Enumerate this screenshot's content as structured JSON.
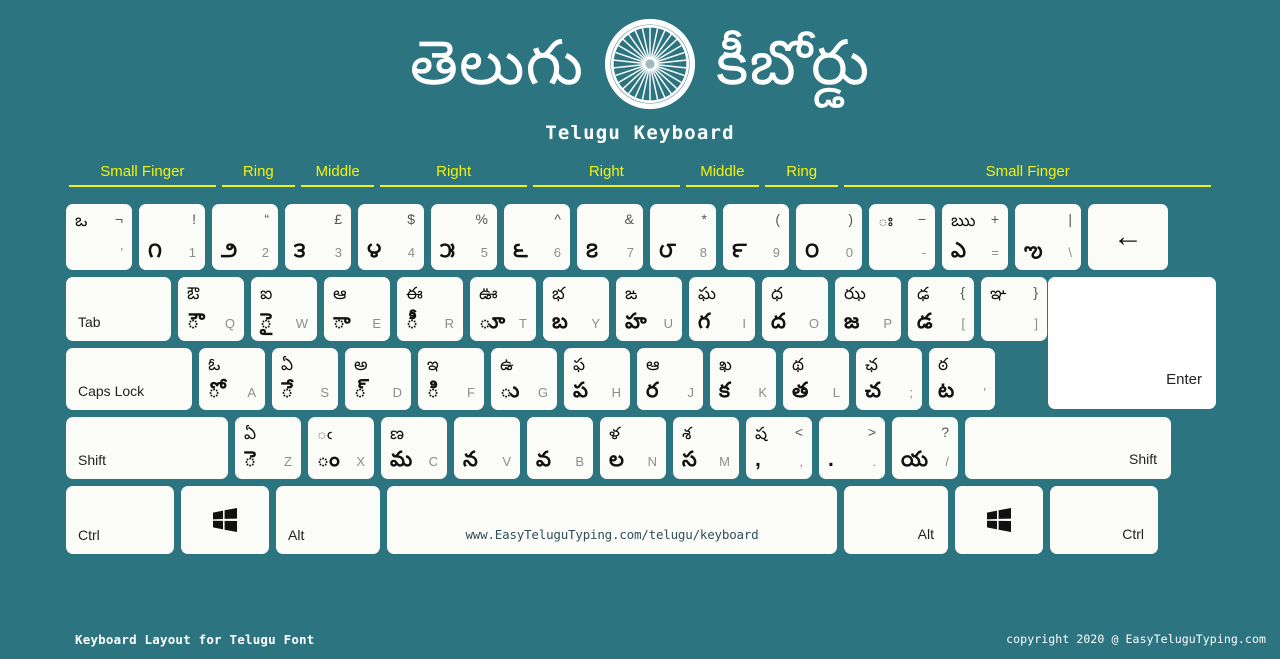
{
  "theme": {
    "background": "#2c7480",
    "key_face": "#fbfbf8",
    "accent_yellow": "#f2f20c",
    "text_light": "#ffffff",
    "text_dark": "#111111"
  },
  "header": {
    "title_left": "తెలుగు",
    "title_right": "కీబోర్డు",
    "chakra_icon": "ashoka-chakra-icon",
    "subtitle": "Telugu Keyboard"
  },
  "finger_guide": [
    {
      "label": "Small Finger",
      "span": 2
    },
    {
      "label": "Ring",
      "span": 1
    },
    {
      "label": "Middle",
      "span": 1
    },
    {
      "label": "Right",
      "span": 2
    },
    {
      "label": "Right",
      "span": 2
    },
    {
      "label": "Middle",
      "span": 1
    },
    {
      "label": "Ring",
      "span": 1
    },
    {
      "label": "Small Finger",
      "span": 5
    }
  ],
  "rows": {
    "row1": [
      {
        "name": "key-backquote",
        "tl": "ఒ",
        "tr": "¬",
        "bl": "",
        "br": "'"
      },
      {
        "name": "key-1",
        "tl": "",
        "tr": "!",
        "bl": "౧",
        "br": "1"
      },
      {
        "name": "key-2",
        "tl": "",
        "tr": "“",
        "bl": "౨",
        "br": "2"
      },
      {
        "name": "key-3",
        "tl": "",
        "tr": "£",
        "bl": "౩",
        "br": "3"
      },
      {
        "name": "key-4",
        "tl": "",
        "tr": "$",
        "bl": "౪",
        "br": "4"
      },
      {
        "name": "key-5",
        "tl": "",
        "tr": "%",
        "bl": "౫",
        "br": "5"
      },
      {
        "name": "key-6",
        "tl": "",
        "tr": "^",
        "bl": "౬",
        "br": "6"
      },
      {
        "name": "key-7",
        "tl": "",
        "tr": "&",
        "bl": "౭",
        "br": "7"
      },
      {
        "name": "key-8",
        "tl": "",
        "tr": "*",
        "bl": "౮",
        "br": "8"
      },
      {
        "name": "key-9",
        "tl": "",
        "tr": "(",
        "bl": "౯",
        "br": "9"
      },
      {
        "name": "key-0",
        "tl": "",
        "tr": ")",
        "bl": "౦",
        "br": "0"
      },
      {
        "name": "key-minus",
        "tl": "ః",
        "tr": "−",
        "bl": "",
        "br": "-"
      },
      {
        "name": "key-equal",
        "tl": "ఋ",
        "tr": "+",
        "bl": "ఎ",
        "br": "="
      },
      {
        "name": "key-backslash",
        "tl": "",
        "tr": "|",
        "bl": "ఌ",
        "br": "\\"
      },
      {
        "name": "key-backspace",
        "label": "←",
        "type": "arrow",
        "width": "w-bksp"
      }
    ],
    "row2": [
      {
        "name": "key-tab",
        "label": "Tab",
        "type": "wide-left",
        "width": "w-tab"
      },
      {
        "name": "key-q",
        "tl": "ఔ",
        "tr": "",
        "bl": "ౌ",
        "br": "Q"
      },
      {
        "name": "key-w",
        "tl": "ఐ",
        "tr": "",
        "bl": "ై",
        "br": "W"
      },
      {
        "name": "key-e",
        "tl": "ఆ",
        "tr": "",
        "bl": "ా",
        "br": "E"
      },
      {
        "name": "key-r",
        "tl": "ఈ",
        "tr": "",
        "bl": "ీ",
        "br": "R"
      },
      {
        "name": "key-t",
        "tl": "ఊ",
        "tr": "",
        "bl": "ూ",
        "br": "T"
      },
      {
        "name": "key-y",
        "tl": "భ",
        "tr": "",
        "bl": "బ",
        "br": "Y"
      },
      {
        "name": "key-u",
        "tl": "ఙ",
        "tr": "",
        "bl": "హ",
        "br": "U"
      },
      {
        "name": "key-i",
        "tl": "ఘ",
        "tr": "",
        "bl": "గ",
        "br": "I"
      },
      {
        "name": "key-o",
        "tl": "ధ",
        "tr": "",
        "bl": "ద",
        "br": "O"
      },
      {
        "name": "key-p",
        "tl": "ఝ",
        "tr": "",
        "bl": "జ",
        "br": "P"
      },
      {
        "name": "key-bracketleft",
        "tl": "ఢ",
        "tr": "{",
        "bl": "డ",
        "br": "["
      },
      {
        "name": "key-bracketright",
        "tl": "ఞ",
        "tr": "}",
        "bl": "",
        "br": "]"
      }
    ],
    "row3": [
      {
        "name": "key-capslock",
        "label": "Caps Lock",
        "type": "wide-left",
        "width": "w-caps"
      },
      {
        "name": "key-a",
        "tl": "ఓ",
        "tr": "",
        "bl": "ో",
        "br": "A"
      },
      {
        "name": "key-s",
        "tl": "ఏ",
        "tr": "",
        "bl": "ే",
        "br": "S"
      },
      {
        "name": "key-d",
        "tl": "అ",
        "tr": "",
        "bl": "్",
        "br": "D"
      },
      {
        "name": "key-f",
        "tl": "ఇ",
        "tr": "",
        "bl": "ి",
        "br": "F"
      },
      {
        "name": "key-g",
        "tl": "ఉ",
        "tr": "",
        "bl": "ు",
        "br": "G"
      },
      {
        "name": "key-h",
        "tl": "ఫ",
        "tr": "",
        "bl": "ప",
        "br": "H"
      },
      {
        "name": "key-j",
        "tl": "ఆ",
        "tr": "",
        "bl": "ర",
        "br": "J"
      },
      {
        "name": "key-k",
        "tl": "ఖ",
        "tr": "",
        "bl": "క",
        "br": "K"
      },
      {
        "name": "key-l",
        "tl": "థ",
        "tr": "",
        "bl": "త",
        "br": "L"
      },
      {
        "name": "key-semicolon",
        "tl": "ఛ",
        "tr": "",
        "bl": "చ",
        "br": ";"
      },
      {
        "name": "key-quote",
        "tl": "ఠ",
        "tr": "",
        "bl": "ట",
        "br": "'"
      }
    ],
    "row3_enter": {
      "name": "key-enter",
      "label": "Enter"
    },
    "row4": [
      {
        "name": "key-shift-left",
        "label": "Shift",
        "type": "wide-left",
        "width": "w-shiftL"
      },
      {
        "name": "key-z",
        "tl": "ఏ",
        "tr": "",
        "bl": "ె",
        "br": "Z"
      },
      {
        "name": "key-x",
        "tl": "ఁ",
        "tr": "",
        "bl": "ం",
        "br": "X"
      },
      {
        "name": "key-c",
        "tl": "ణ",
        "tr": "",
        "bl": "మ",
        "br": "C"
      },
      {
        "name": "key-v",
        "tl": "",
        "tr": "",
        "bl": "న",
        "br": "V"
      },
      {
        "name": "key-b",
        "tl": "",
        "tr": "",
        "bl": "వ",
        "br": "B"
      },
      {
        "name": "key-n",
        "tl": "ళ",
        "tr": "",
        "bl": "ల",
        "br": "N"
      },
      {
        "name": "key-m",
        "tl": "శ",
        "tr": "",
        "bl": "స",
        "br": "M"
      },
      {
        "name": "key-comma",
        "tl": "ష",
        "tr": "<",
        "bl": ",",
        "br": ","
      },
      {
        "name": "key-period",
        "tl": "",
        "tr": ">",
        "bl": ".",
        "br": "."
      },
      {
        "name": "key-slash",
        "tl": "",
        "tr": "?",
        "bl": "య",
        "br": "/"
      },
      {
        "name": "key-shift-right",
        "label": "Shift",
        "type": "wide-right",
        "width": "w-shiftR"
      }
    ],
    "row5": [
      {
        "name": "key-ctrl-left",
        "label": "Ctrl",
        "type": "wide-left",
        "width": "w-ctrl"
      },
      {
        "name": "key-win-left",
        "label": "",
        "type": "win",
        "width": "w-win"
      },
      {
        "name": "key-alt-left",
        "label": "Alt",
        "type": "wide-left",
        "width": "w-alt"
      },
      {
        "name": "key-space",
        "label": "",
        "type": "space",
        "width": "w-space"
      },
      {
        "name": "key-alt-right",
        "label": "Alt",
        "type": "wide-right",
        "width": "w-alt"
      },
      {
        "name": "key-win-right",
        "label": "",
        "type": "win",
        "width": "w-win"
      },
      {
        "name": "key-ctrl-right",
        "label": "Ctrl",
        "type": "wide-right",
        "width": "w-ctrl"
      }
    ]
  },
  "spacebar_url": "www.EasyTeluguTyping.com/telugu/keyboard",
  "footer": {
    "left": "Keyboard Layout for Telugu Font",
    "right": "copyright 2020 @ EasyTeluguTyping.com"
  }
}
